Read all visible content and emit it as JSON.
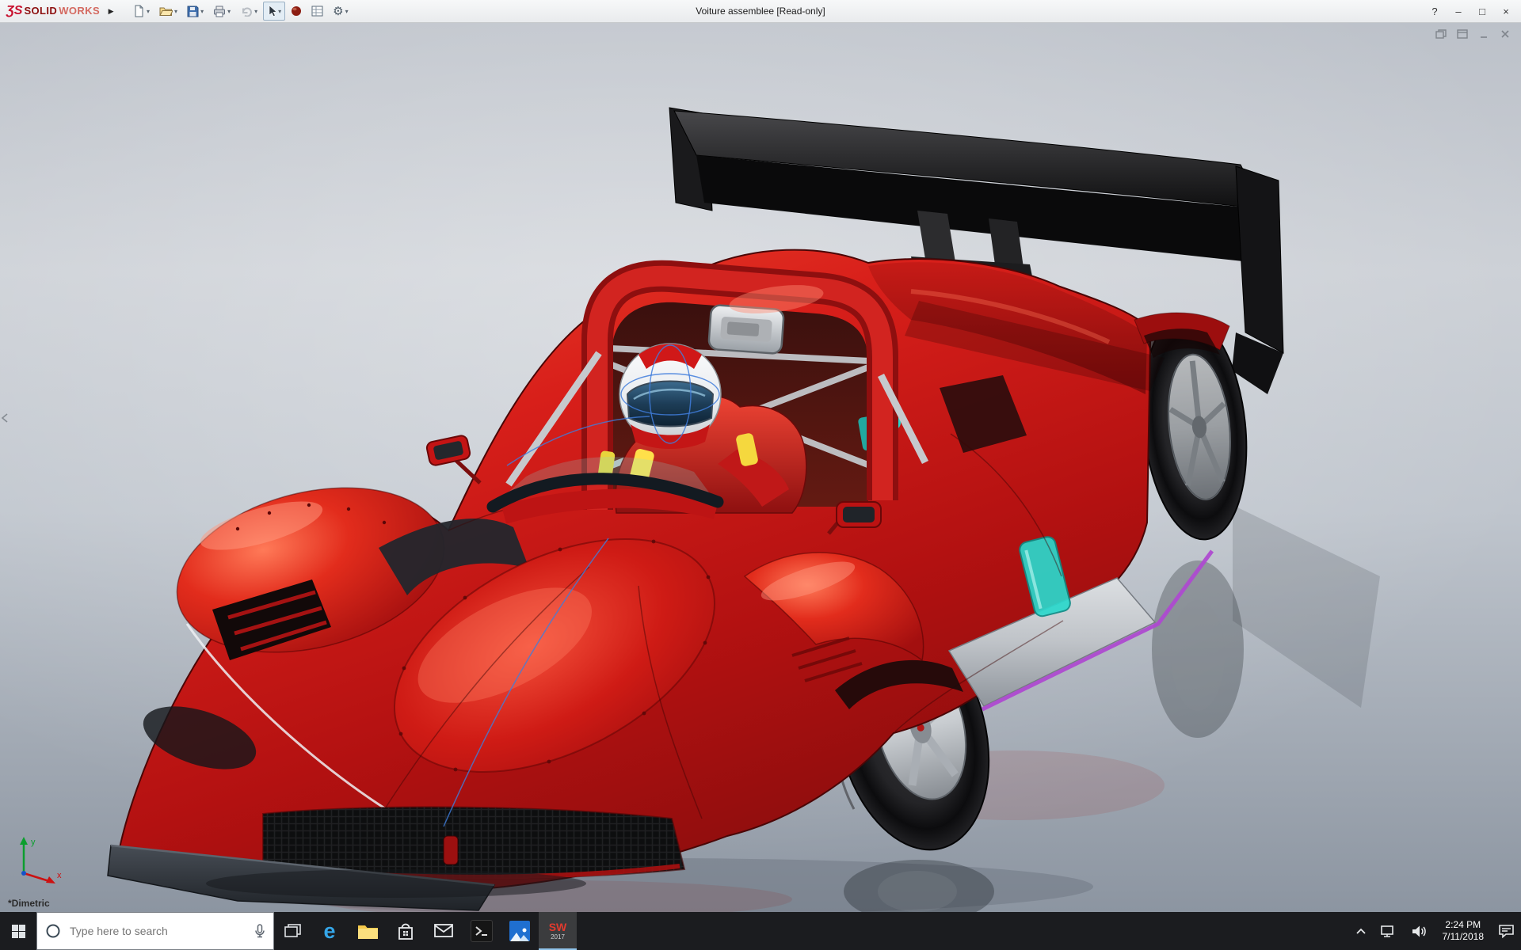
{
  "ui": {
    "caret": "▾",
    "menu_arrow": "▶",
    "help": "?",
    "minimize": "–",
    "maximize": "□",
    "close": "×"
  },
  "titlebar": {
    "brand_mark": "ƷS",
    "brand_solid": "SOLID",
    "brand_works": "WORKS",
    "title": "Voiture assemblee [Read-only]",
    "toolbar_items": [
      {
        "name": "new-document"
      },
      {
        "name": "open"
      },
      {
        "name": "save"
      },
      {
        "name": "print"
      },
      {
        "name": "undo"
      },
      {
        "name": "select-arrow"
      },
      {
        "name": "appearance-sphere"
      },
      {
        "name": "mass-properties-table"
      },
      {
        "name": "options-gear"
      }
    ]
  },
  "viewport": {
    "orientation_label": "*Dimetric",
    "triad_x": "x",
    "triad_y": "y"
  },
  "taskbar": {
    "search_placeholder": "Type here to search",
    "time": "2:24 PM",
    "date": "7/11/2018",
    "edge_glyph": "e",
    "sw_top": "SW",
    "sw_bottom": "2017"
  },
  "colors": {
    "car_red": "#c81616",
    "wing_black": "#141416",
    "accent_cyan": "#2bd8cc",
    "sill_purple": "#b04cd4",
    "background_top": "#c3c8d0",
    "background_bottom": "#8e97a2",
    "taskbar": "#1b1c1f"
  }
}
